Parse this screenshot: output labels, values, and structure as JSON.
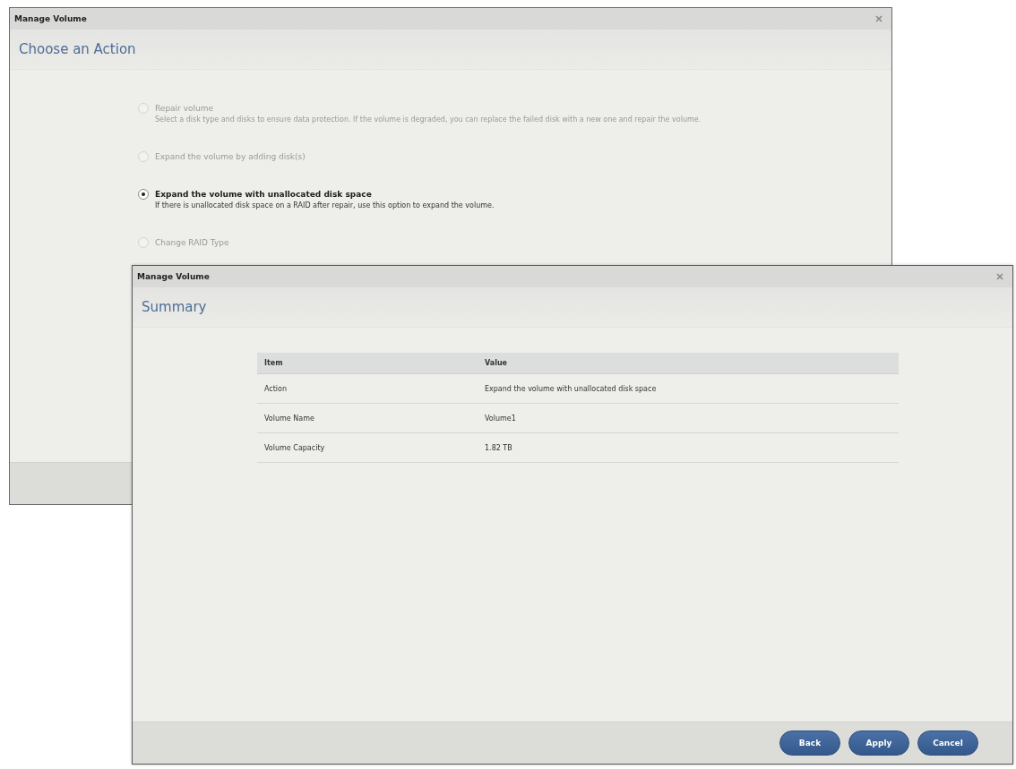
{
  "action_dialog": {
    "title": "Manage Volume",
    "heading": "Choose an Action",
    "options": [
      {
        "title": "Repair volume",
        "description": "Select a disk type and disks to ensure data protection. If the volume is degraded, you can replace the failed disk with a new one and repair the volume.",
        "selected": false,
        "disabled": true
      },
      {
        "title": "Expand the volume by adding disk(s)",
        "selected": false,
        "disabled": true
      },
      {
        "title": "Expand the volume with unallocated disk space",
        "description": "If there is unallocated disk space on a RAID after repair, use this option to expand the volume.",
        "selected": true,
        "disabled": false
      },
      {
        "title": "Change RAID Type",
        "selected": false,
        "disabled": true
      }
    ]
  },
  "summary_dialog": {
    "title": "Manage Volume",
    "heading": "Summary",
    "table": {
      "columns": [
        "Item",
        "Value"
      ],
      "rows": [
        [
          "Action",
          "Expand the volume with unallocated disk space"
        ],
        [
          "Volume Name",
          "Volume1"
        ],
        [
          "Volume Capacity",
          "1.82 TB"
        ]
      ]
    },
    "buttons": [
      "Back",
      "Apply",
      "Cancel"
    ]
  }
}
